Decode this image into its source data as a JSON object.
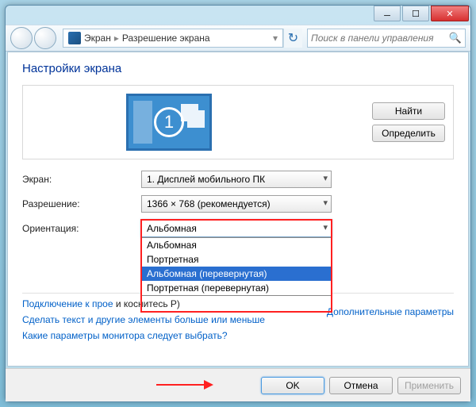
{
  "breadcrumb": {
    "item1": "Экран",
    "item2": "Разрешение экрана"
  },
  "search": {
    "placeholder": "Поиск в панели управления"
  },
  "heading": "Настройки экрана",
  "preview": {
    "monitor_number": "1"
  },
  "buttons": {
    "find": "Найти",
    "detect": "Определить"
  },
  "labels": {
    "screen": "Экран:",
    "resolution": "Разрешение:",
    "orientation": "Ориентация:"
  },
  "combos": {
    "screen": "1. Дисплей мобильного ПК",
    "resolution": "1366 × 768 (рекомендуется)",
    "orientation_selected": "Альбомная",
    "orientation_options": [
      "Альбомная",
      "Портретная",
      "Альбомная (перевернутая)",
      "Портретная (перевернутая)"
    ]
  },
  "links": {
    "advanced": "Дополнительные параметры",
    "projector_prefix": "Подключение к прое",
    "projector_suffix": "и коснитесь P)",
    "text_size": "Сделать текст и другие элементы больше или меньше",
    "monitor_q": "Какие параметры монитора следует выбрать?"
  },
  "footer": {
    "ok": "OK",
    "cancel": "Отмена",
    "apply": "Применить"
  }
}
